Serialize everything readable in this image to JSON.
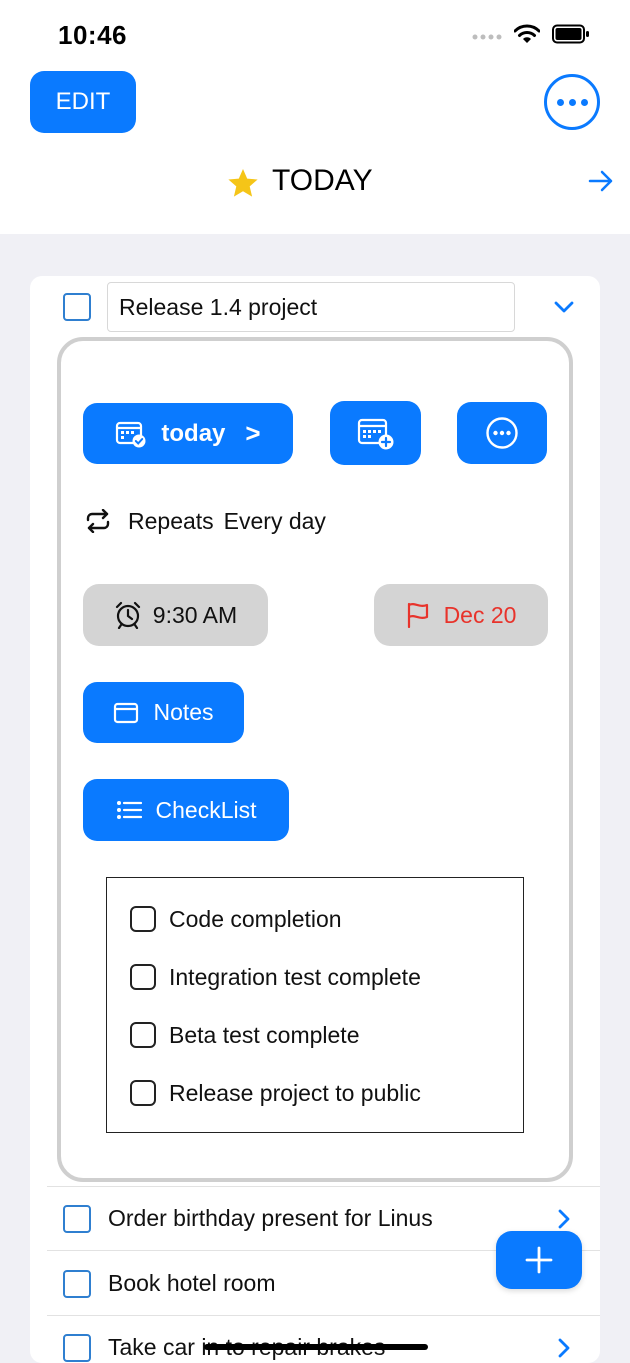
{
  "status_bar": {
    "time": "10:46",
    "icons": [
      "signal-dots-icon",
      "wifi-icon",
      "battery-icon"
    ]
  },
  "header": {
    "edit_label": "EDIT",
    "more_icon": "ellipsis-circle-icon",
    "title": "TODAY",
    "title_icon": "star-icon",
    "forward_icon": "arrow-right-icon"
  },
  "task": {
    "name": "Release 1.4 project",
    "expanded": true,
    "detail": {
      "date_button_label": "today",
      "date_button_suffix": ">",
      "add_date_icon": "calendar-add-icon",
      "more_icon": "ellipsis-circle-icon",
      "repeats_label": "Repeats",
      "repeats_value": "Every day",
      "alarm_time": "9:30 AM",
      "due_date": "Dec 20",
      "notes_label": "Notes",
      "checklist_label": "CheckList",
      "checklist": [
        {
          "text": "Code completion",
          "checked": false
        },
        {
          "text": "Integration test complete",
          "checked": false
        },
        {
          "text": "Beta test complete",
          "checked": false
        },
        {
          "text": "Release project to public",
          "checked": false
        }
      ]
    }
  },
  "tasks": [
    {
      "text": "Order birthday present for Linus"
    },
    {
      "text": "Book hotel room"
    },
    {
      "text": "Take car in to repair brakes"
    }
  ],
  "colors": {
    "accent": "#0a7aff",
    "due_red": "#e8332b",
    "gray_button": "#d4d4d4",
    "star": "#f5c518",
    "background": "#f0f0f5"
  }
}
